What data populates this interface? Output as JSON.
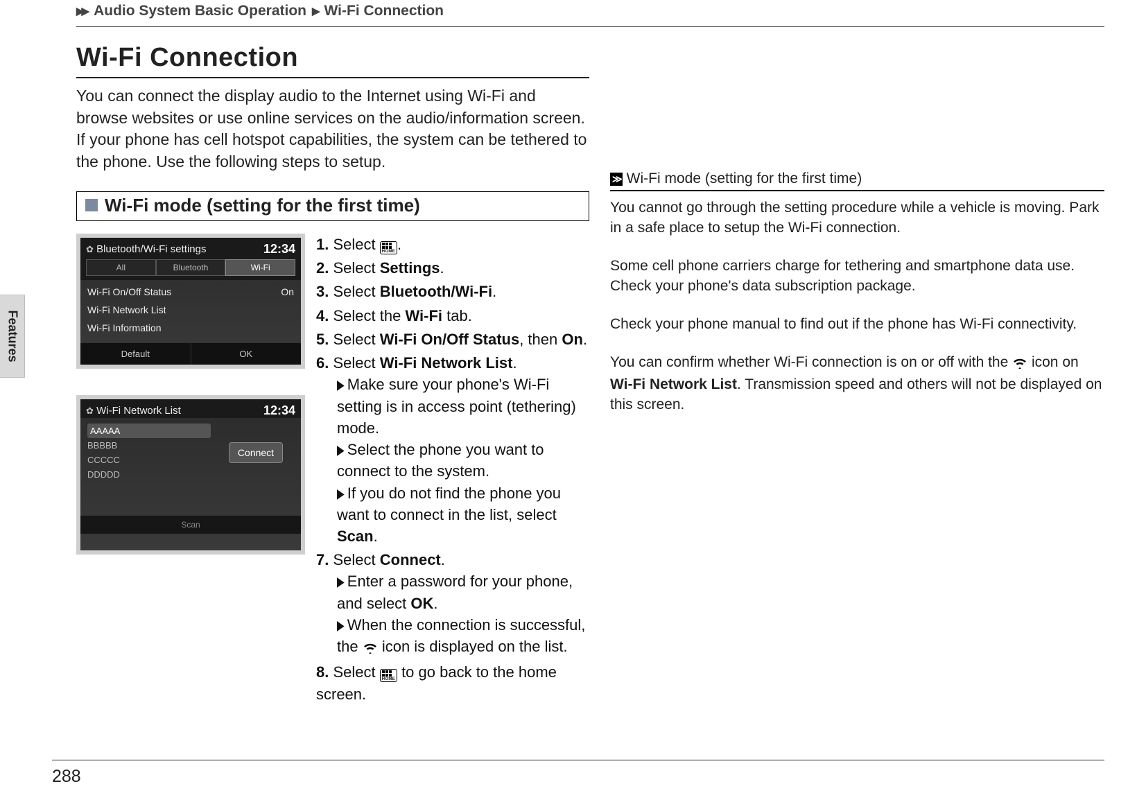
{
  "breadcrumb": {
    "level1": "Audio System Basic Operation",
    "level2": "Wi-Fi Connection"
  },
  "title": "Wi-Fi Connection",
  "intro": "You can connect the display audio to the Internet using Wi-Fi and browse websites or use online services on the audio/information screen. If your phone has cell hotspot capabilities, the system can be tethered to the phone. Use the following steps to setup.",
  "section_heading": "Wi-Fi mode (setting for the first time)",
  "screenshot1": {
    "header": "Bluetooth/Wi-Fi settings",
    "clock": "12:34",
    "tabs": {
      "all": "All",
      "bluetooth": "Bluetooth",
      "wifi": "Wi-Fi"
    },
    "rows": {
      "status_label": "Wi-Fi On/Off Status",
      "status_value": "On",
      "netlist": "Wi-Fi Network List",
      "info": "Wi-Fi Information"
    },
    "footer": {
      "default": "Default",
      "ok": "OK"
    }
  },
  "screenshot2": {
    "header": "Wi-Fi Network List",
    "clock": "12:34",
    "networks": [
      "AAAAA",
      "BBBBB",
      "CCCCC",
      "DDDDD"
    ],
    "connect": "Connect",
    "scan": "Scan"
  },
  "steps": {
    "s1a": "Select ",
    "s1b": ".",
    "s2a": "Select ",
    "s2b": "Settings",
    "s2c": ".",
    "s3a": "Select ",
    "s3b": "Bluetooth/Wi-Fi",
    "s3c": ".",
    "s4a": "Select the ",
    "s4b": "Wi-Fi",
    "s4c": " tab.",
    "s5a": "Select ",
    "s5b": "Wi-Fi On/Off Status",
    "s5c": ", then ",
    "s5d": "On",
    "s5e": ".",
    "s6a": "Select ",
    "s6b": "Wi-Fi Network List",
    "s6c": ".",
    "s6s1": "Make sure your phone's Wi-Fi setting is in access point (tethering) mode.",
    "s6s2": "Select the phone you want to connect to the system.",
    "s6s3a": "If you do not find the phone you want to connect in the list, select ",
    "s6s3b": "Scan",
    "s6s3c": ".",
    "s7a": "Select ",
    "s7b": "Connect",
    "s7c": ".",
    "s7s1a": "Enter a password for your phone, and select ",
    "s7s1b": "OK",
    "s7s1c": ".",
    "s7s2a": "When the connection is successful, the ",
    "s7s2b": " icon is displayed on the list.",
    "s8a": "Select ",
    "s8b": " to go back to the home screen."
  },
  "home_label": "HOME",
  "sidebox": {
    "heading": "Wi-Fi mode (setting for the first time)",
    "p1": "You cannot go through the setting procedure while a vehicle is moving. Park in a safe place to setup the Wi-Fi connection.",
    "p2": "Some cell phone carriers charge for tethering and smartphone data use. Check your phone's data subscription package.",
    "p3": "Check your phone manual to find out if the phone has Wi-Fi connectivity.",
    "p4a": "You can confirm whether Wi-Fi connection is on or off with the ",
    "p4b": " icon on ",
    "p4c": "Wi-Fi Network List",
    "p4d": ". Transmission speed and others will not be displayed on this screen."
  },
  "side_tab": "Features",
  "page_number": "288"
}
